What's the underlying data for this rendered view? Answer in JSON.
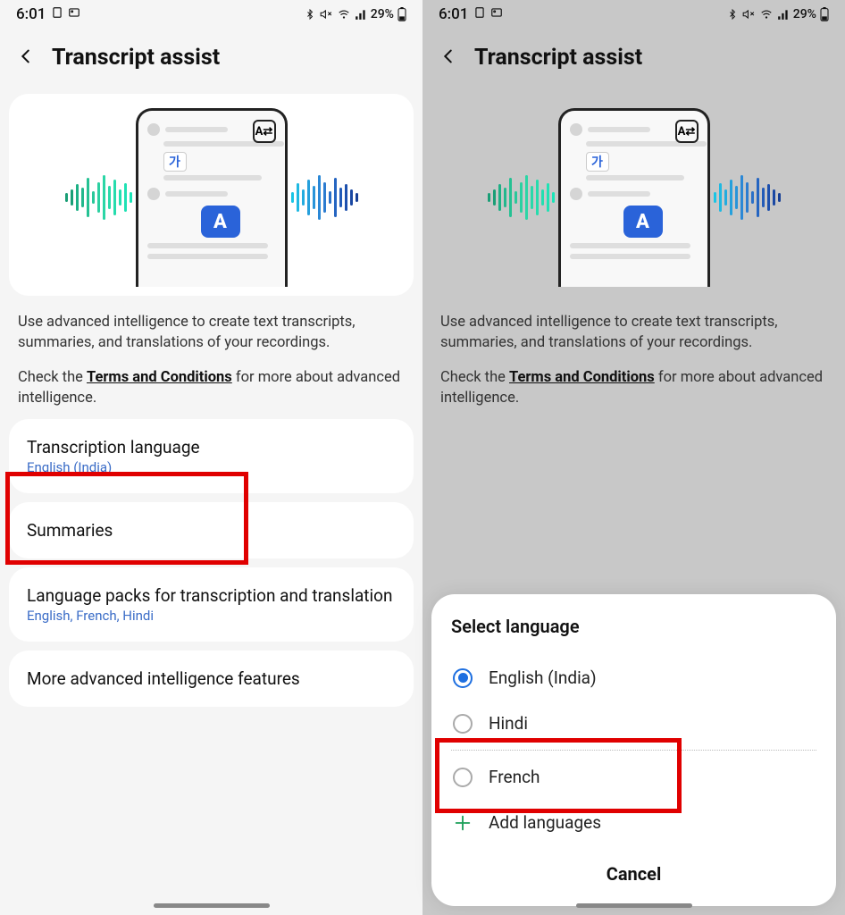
{
  "status": {
    "time": "6:01",
    "battery_text": "29%"
  },
  "header": {
    "title": "Transcript assist"
  },
  "hero": {
    "badge_ga": "가",
    "badge_a": "A"
  },
  "description": "Use advanced intelligence to create text transcripts, summaries, and translations of your recordings.",
  "terms": {
    "prefix": "Check the ",
    "link": "Terms and Conditions",
    "suffix": " for more about advanced intelligence."
  },
  "settings": [
    {
      "title": "Transcription language",
      "sub": "English (India)"
    },
    {
      "title": "Summaries",
      "sub": ""
    },
    {
      "title": "Language packs for transcription and translation",
      "sub": "English, French, Hindi"
    },
    {
      "title": "More advanced intelligence features",
      "sub": ""
    }
  ],
  "sheet": {
    "title": "Select language",
    "options": [
      {
        "label": "English (India)",
        "selected": true
      },
      {
        "label": "Hindi",
        "selected": false
      },
      {
        "label": "French",
        "selected": false
      }
    ],
    "add_label": "Add languages",
    "cancel_label": "Cancel"
  }
}
